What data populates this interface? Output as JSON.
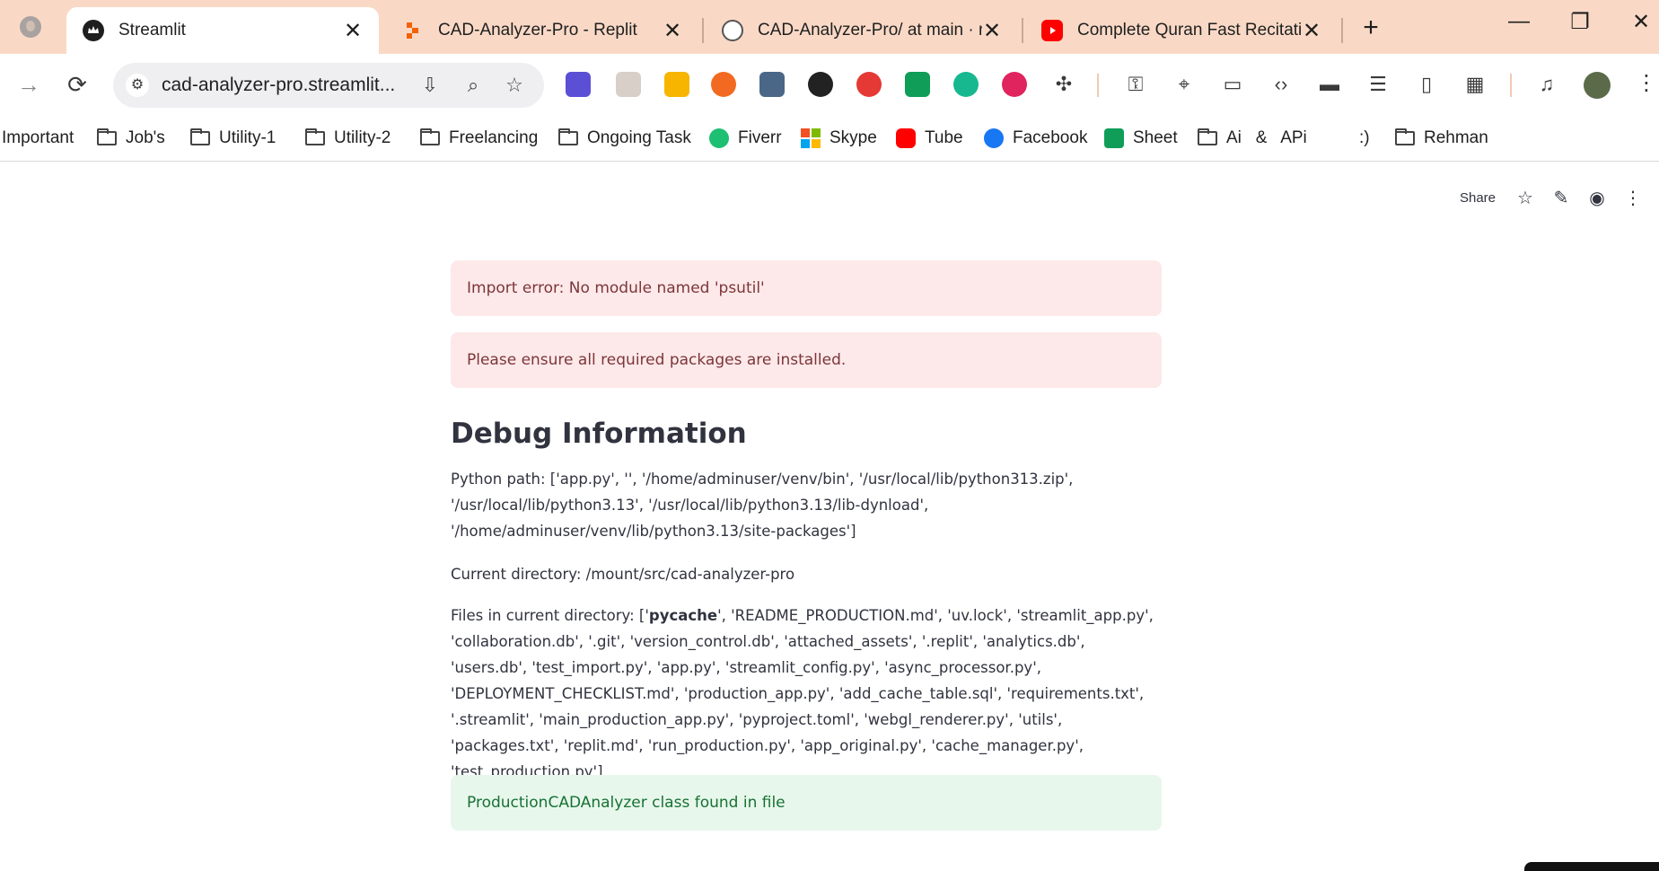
{
  "browser": {
    "tabs": [
      {
        "title": "Streamlit",
        "favicon": "streamlit-crown-icon",
        "active": true
      },
      {
        "title": "CAD-Analyzer-Pro - Replit",
        "favicon": "replit-icon",
        "active": false
      },
      {
        "title": "CAD-Analyzer-Pro/ at main · rel",
        "favicon": "github-icon",
        "active": false
      },
      {
        "title": "Complete Quran Fast Recitation",
        "favicon": "youtube-icon",
        "active": false
      }
    ],
    "new_tab": "+",
    "window_controls": {
      "minimize": "—",
      "restore": "❐",
      "close": "✕"
    },
    "address": "cad-analyzer-pro.streamlit...",
    "bookmarks": [
      {
        "label": "Important",
        "type": "text"
      },
      {
        "label": "Job's",
        "type": "folder"
      },
      {
        "label": "Utility-1",
        "type": "folder"
      },
      {
        "label": "Utility-2",
        "type": "folder"
      },
      {
        "label": "Freelancing",
        "type": "folder"
      },
      {
        "label": "Ongoing Task",
        "type": "folder"
      },
      {
        "label": "Fiverr",
        "type": "fiverr-icon"
      },
      {
        "label": "Skype",
        "type": "windows-icon"
      },
      {
        "label": "Tube",
        "type": "youtube-icon"
      },
      {
        "label": "Facebook",
        "type": "facebook-icon"
      },
      {
        "label": "Sheet",
        "type": "sheets-icon"
      },
      {
        "label": "Ai   &   APi",
        "type": "folder"
      },
      {
        "label": ":)",
        "type": "text"
      },
      {
        "label": "Rehman",
        "type": "folder"
      }
    ]
  },
  "colors": {
    "tab_strip": "#f9d9c6",
    "error_bg": "#fde9e9",
    "error_text": "#7d353b",
    "success_bg": "#e8f7ec",
    "success_text": "#177233",
    "text": "#31333f"
  },
  "app": {
    "header": {
      "share": "Share"
    },
    "alerts": {
      "import_error": "Import error: No module named 'psutil'",
      "packages_error": "Please ensure all required packages are installed."
    },
    "debug": {
      "heading": "Debug Information",
      "python_path": "Python path: ['app.py', '', '/home/adminuser/venv/bin', '/usr/local/lib/python313.zip', '/usr/local/lib/python3.13', '/usr/local/lib/python3.13/lib-dynload', '/home/adminuser/venv/lib/python3.13/site-packages']",
      "current_directory": "Current directory: /mount/src/cad-analyzer-pro",
      "files_prefix": "Files in current directory: ['",
      "files_bold": "pycache",
      "files_rest": "', 'README_PRODUCTION.md', 'uv.lock', 'streamlit_app.py', 'collaboration.db', '.git', 'version_control.db', 'attached_assets', '.replit', 'analytics.db', 'users.db', 'test_import.py', 'app.py', 'streamlit_config.py', 'async_processor.py', 'DEPLOYMENT_CHECKLIST.md', 'production_app.py', 'add_cache_table.sql', 'requirements.txt', '.streamlit', 'main_production_app.py', 'pyproject.toml', 'webgl_renderer.py', 'utils', 'packages.txt', 'replit.md', 'run_production.py', 'app_original.py', 'cache_manager.py', 'test_production.py']"
    },
    "success": "ProductionCADAnalyzer class found in file"
  }
}
